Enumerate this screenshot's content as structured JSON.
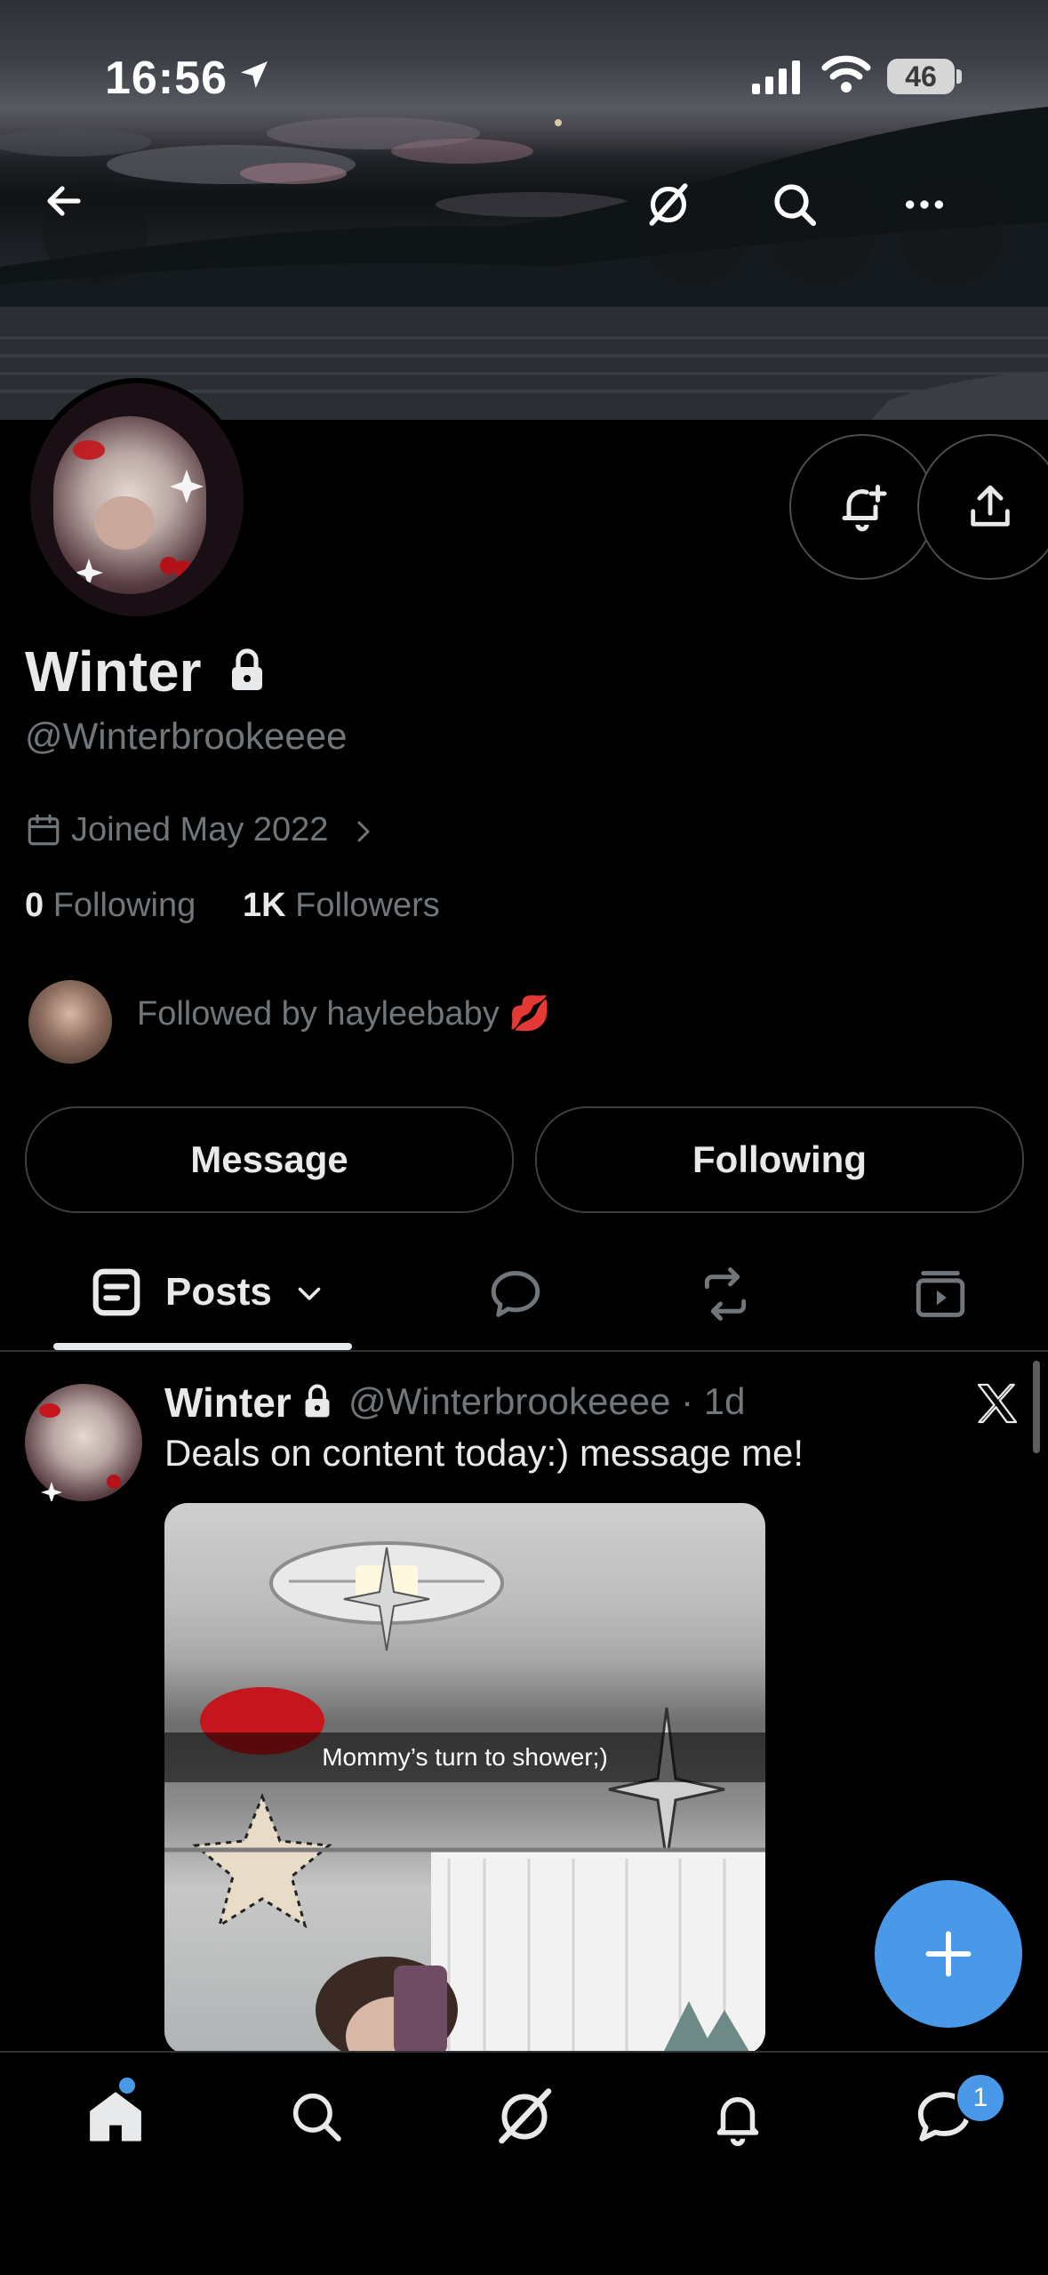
{
  "status_bar": {
    "time": "16:56",
    "battery": "46"
  },
  "header": {
    "back_icon": "arrow-left-icon",
    "grok_icon": "grok-icon",
    "search_icon": "search-icon",
    "more_icon": "more-horizontal-icon"
  },
  "profile": {
    "name": "Winter",
    "handle": "@Winterbrookeeee",
    "joined": "Joined May 2022",
    "following_count": "0",
    "following_label": "Following",
    "followers_count": "1K",
    "followers_label": "Followers",
    "followed_by": "Followed by hayleebaby",
    "followed_by_emoji": "💋"
  },
  "actions": {
    "message": "Message",
    "following": "Following"
  },
  "tabs": {
    "posts": "Posts"
  },
  "post": {
    "name": "Winter",
    "handle_time": "@Winterbrookeeee · 1d",
    "text": "Deals on content today:) message me!",
    "media_caption": "Mommy’s turn to shower;)"
  },
  "nav": {
    "messages_badge": "1"
  },
  "colors": {
    "accent": "#4a99e9",
    "text": "#e7e9ea",
    "muted": "#71767b",
    "background": "#000000"
  }
}
